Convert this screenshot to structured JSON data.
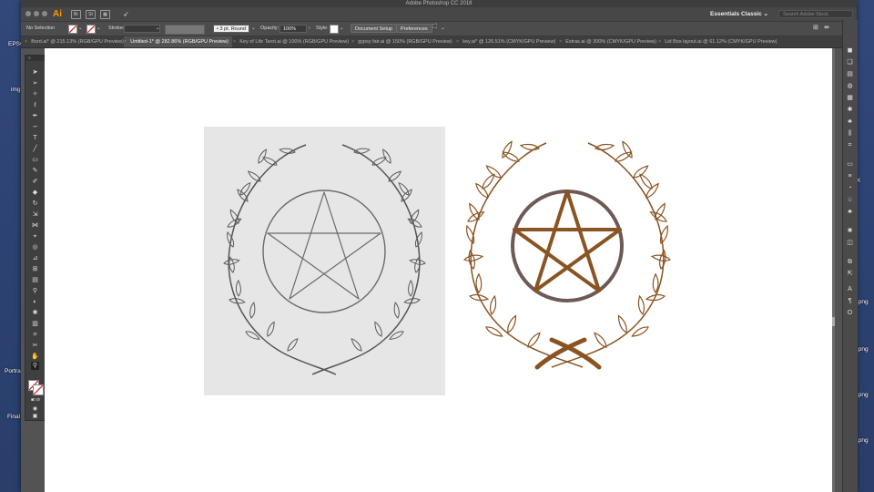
{
  "window": {
    "title": "Adobe Photoshop CC 2018"
  },
  "desktop": {
    "items": [
      "EPSO",
      "img",
      "Portra",
      "Final",
      ".png",
      ".png",
      ".png",
      ".png",
      "X"
    ]
  },
  "appbar": {
    "logo": "Ai",
    "br_label": "Br",
    "st_label": "St",
    "workspace": "Essentials Classic",
    "search_placeholder": "Search Adobe Stock"
  },
  "control": {
    "selection": "No Selection",
    "stroke_label": "Stroke:",
    "brush_value": "3 pt. Round",
    "opacity_label": "Opacity:",
    "opacity_value": "100%",
    "style_label": "Style:",
    "doc_setup": "Document Setup",
    "preferences": "Preferences"
  },
  "tabs": [
    {
      "label": "Bord.ai* @ 215.13% (RGB/GPU Preview)"
    },
    {
      "label": "Untitled-1* @ 282.86% (RGB/GPU Preview)"
    },
    {
      "label": "Key of Life Tarot.ai @ 100% (RGB/GPU Preview)"
    },
    {
      "label": "gypsy fair.ai @ 150% (RGB/GPU Preview)"
    },
    {
      "label": "key.ai* @ 126.51% (CMYK/GPU Preview)"
    },
    {
      "label": "Extras.ai @ 300% (CMYK/GPU Preview)"
    },
    {
      "label": "Lid Box layout.ai @ 61.12% (CMYK/GPU Preview)"
    }
  ],
  "colors": {
    "accent": "#ff9a00",
    "vector_stroke": "#8a5322",
    "circle_stroke": "#6e5a55",
    "sketch_line": "#555555"
  },
  "icons": {
    "tools": [
      "selection-tool-icon",
      "direct-selection-tool-icon",
      "magic-wand-icon",
      "lasso-icon",
      "pen-tool-icon",
      "curvature-tool-icon",
      "type-tool-icon",
      "line-tool-icon",
      "rectangle-tool-icon",
      "paintbrush-icon",
      "pencil-icon",
      "eraser-icon",
      "rotate-icon",
      "scale-icon",
      "width-tool-icon",
      "free-transform-icon",
      "shape-builder-icon",
      "perspective-icon",
      "mesh-icon",
      "gradient-icon",
      "eyedropper-icon",
      "blend-icon",
      "symbol-sprayer-icon",
      "graph-icon",
      "artboard-icon",
      "slice-icon",
      "hand-icon",
      "zoom-icon"
    ]
  }
}
